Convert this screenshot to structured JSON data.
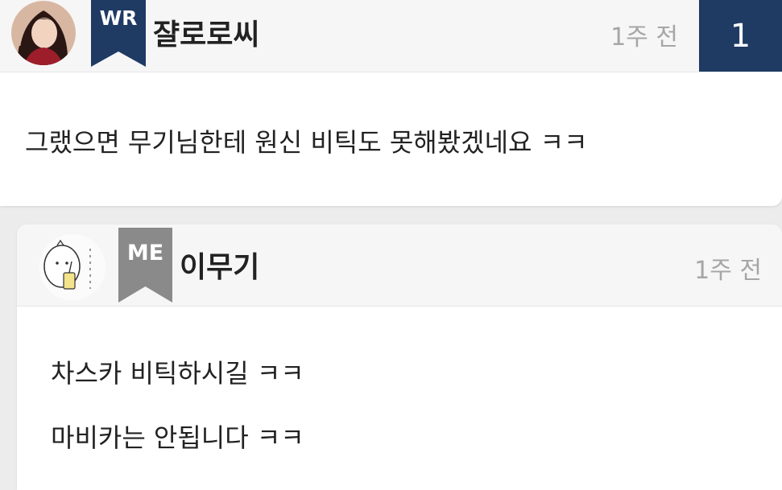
{
  "comments": [
    {
      "badge": "WR",
      "badge_color": "#1f3a63",
      "author": "쟐로로씨",
      "time": "1주 전",
      "count": "1",
      "count_color": "#1f3a63",
      "lines": [
        "그랬으면 무기님한테 원신 비틱도 못해봤겠네요 ㅋㅋ"
      ]
    },
    {
      "badge": "ME",
      "badge_color": "#8a8a8a",
      "author": "이무기",
      "time": "1주 전",
      "lines": [
        "차스카 비틱하시길 ㅋㅋ",
        "마비카는 안됩니다 ㅋㅋ"
      ]
    }
  ]
}
